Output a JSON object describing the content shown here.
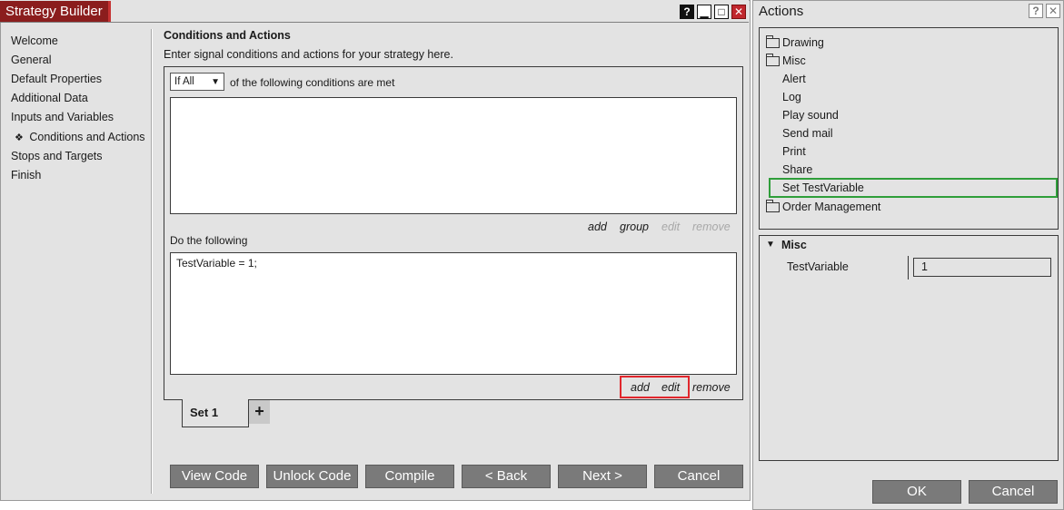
{
  "strategy_builder": {
    "title": "Strategy Builder",
    "window_buttons": [
      "?",
      "▁",
      "□",
      "✕"
    ],
    "nav": [
      {
        "label": "Welcome"
      },
      {
        "label": "General"
      },
      {
        "label": "Default Properties"
      },
      {
        "label": "Additional Data"
      },
      {
        "label": "Inputs and Variables"
      },
      {
        "label": "Conditions and Actions",
        "active": true,
        "marker": "❖"
      },
      {
        "label": "Stops and Targets"
      },
      {
        "label": "Finish"
      }
    ],
    "section_title": "Conditions and Actions",
    "section_description": "Enter signal conditions and actions for your strategy here.",
    "condition_mode": "If All",
    "condition_suffix": "of the following conditions are met",
    "condition_links": {
      "add": "add",
      "group": "group",
      "edit": "edit",
      "remove": "remove"
    },
    "do_label": "Do the following",
    "actions_text": "TestVariable = 1;",
    "action_links": {
      "add": "add",
      "edit": "edit",
      "remove": "remove"
    },
    "tab_label": "Set 1",
    "tab_add": "+",
    "buttons": {
      "view_code": "View Code",
      "unlock_code": "Unlock Code",
      "compile": "Compile",
      "back": "< Back",
      "next": "Next >",
      "cancel": "Cancel"
    }
  },
  "actions_window": {
    "title": "Actions",
    "window_buttons": [
      "?",
      "✕"
    ],
    "tree": {
      "drawing": "Drawing",
      "misc": "Misc",
      "misc_items": [
        "Alert",
        "Log",
        "Play sound",
        "Send mail",
        "Print",
        "Share",
        "Set TestVariable"
      ],
      "selected": "Set TestVariable",
      "order_management": "Order Management"
    },
    "properties": {
      "category": "Misc",
      "name": "TestVariable",
      "value": "1"
    },
    "buttons": {
      "ok": "OK",
      "cancel": "Cancel"
    }
  },
  "colors": {
    "title_red": "#8b1d1d",
    "highlight_red": "#e0262c",
    "selection_green": "#2f9e3a",
    "button_gray": "#7a7a7a"
  }
}
